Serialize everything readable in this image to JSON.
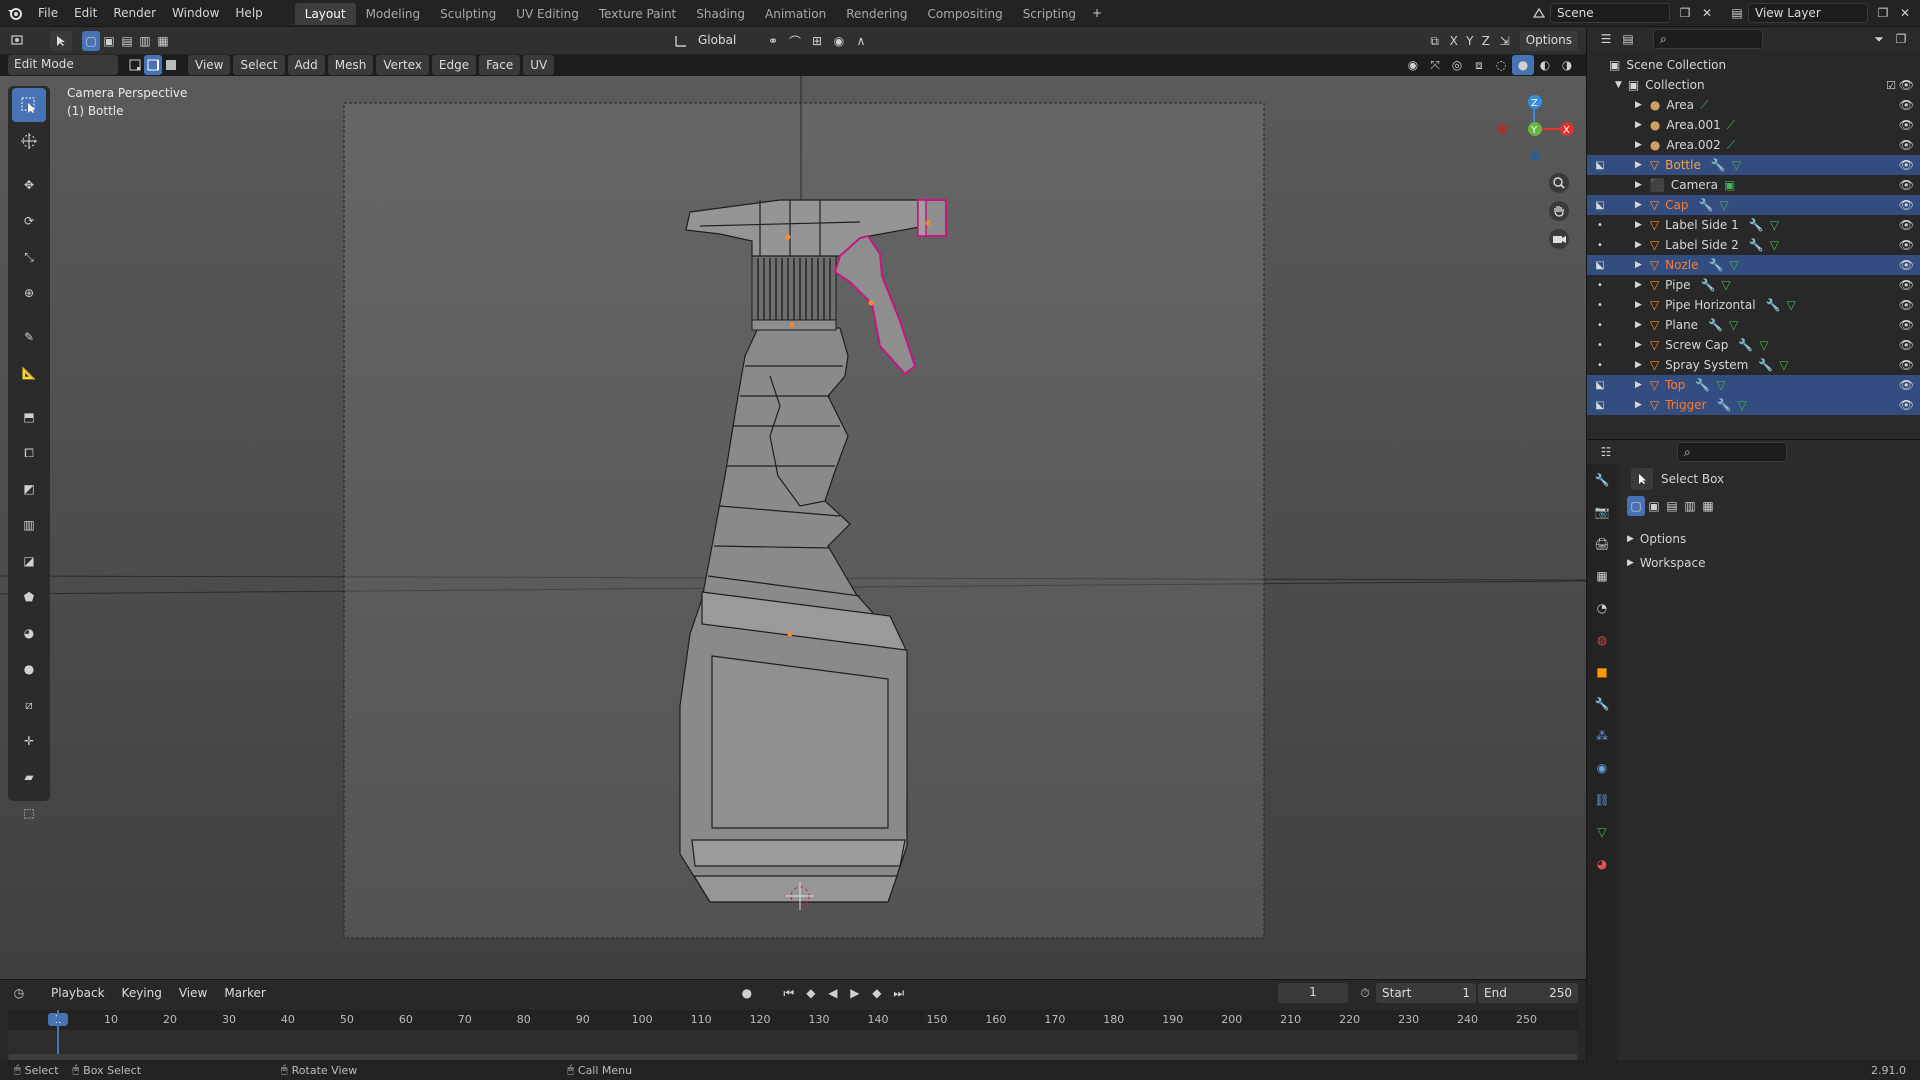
{
  "menubar": {
    "items": [
      "File",
      "Edit",
      "Render",
      "Window",
      "Help"
    ],
    "workspaces": [
      "Layout",
      "Modeling",
      "Sculpting",
      "UV Editing",
      "Texture Paint",
      "Shading",
      "Animation",
      "Rendering",
      "Compositing",
      "Scripting"
    ],
    "active_workspace": "Layout",
    "scene_label": "Scene",
    "view_layer_label": "View Layer"
  },
  "viewport_header": {
    "mode": "Edit Mode",
    "menus": [
      "View",
      "Select",
      "Add",
      "Mesh",
      "Vertex",
      "Edge",
      "Face",
      "UV"
    ],
    "transform_orientation": "Global",
    "axis_labels": [
      "X",
      "Y",
      "Z"
    ],
    "options_label": "Options"
  },
  "viewport": {
    "view_name": "Camera Perspective",
    "object_name": "(1) Bottle",
    "gizmo_labels": {
      "z": "Z",
      "y": "Y",
      "x": "X"
    }
  },
  "outliner": {
    "root": "Scene Collection",
    "collection": "Collection",
    "items": [
      {
        "name": "Area",
        "type": "light",
        "selected": false,
        "edit": false,
        "color": "#d6d6d6"
      },
      {
        "name": "Area.001",
        "type": "light",
        "selected": false,
        "edit": false,
        "color": "#d6d6d6"
      },
      {
        "name": "Area.002",
        "type": "light",
        "selected": false,
        "edit": false,
        "color": "#d6d6d6"
      },
      {
        "name": "Bottle",
        "type": "mesh",
        "selected": true,
        "edit": true,
        "color": "#ff9e40"
      },
      {
        "name": "Camera",
        "type": "camera",
        "selected": false,
        "edit": false,
        "color": "#d6d6d6"
      },
      {
        "name": "Cap",
        "type": "mesh",
        "selected": true,
        "edit": true,
        "color": "#ff7a2a"
      },
      {
        "name": "Label Side 1",
        "type": "mesh",
        "selected": false,
        "edit": false,
        "color": "#d6d6d6"
      },
      {
        "name": "Label Side 2",
        "type": "mesh",
        "selected": false,
        "edit": false,
        "color": "#d6d6d6"
      },
      {
        "name": "Nozle",
        "type": "mesh",
        "selected": true,
        "edit": true,
        "color": "#ff7a2a"
      },
      {
        "name": "Pipe",
        "type": "mesh",
        "selected": false,
        "edit": false,
        "color": "#d6d6d6"
      },
      {
        "name": "Pipe Horizontal",
        "type": "mesh",
        "selected": false,
        "edit": false,
        "color": "#d6d6d6"
      },
      {
        "name": "Plane",
        "type": "mesh",
        "selected": false,
        "edit": false,
        "color": "#d6d6d6"
      },
      {
        "name": "Screw Cap",
        "type": "mesh",
        "selected": false,
        "edit": false,
        "color": "#d6d6d6"
      },
      {
        "name": "Spray System",
        "type": "mesh",
        "selected": false,
        "edit": false,
        "color": "#d6d6d6"
      },
      {
        "name": "Top",
        "type": "mesh",
        "selected": true,
        "edit": true,
        "color": "#ff7a2a"
      },
      {
        "name": "Trigger",
        "type": "mesh",
        "selected": true,
        "edit": true,
        "color": "#ff7a2a"
      }
    ]
  },
  "properties": {
    "tool_name": "Select Box",
    "sections": [
      "Options",
      "Workspace"
    ]
  },
  "timeline": {
    "menus": [
      "Playback",
      "Keying",
      "View",
      "Marker"
    ],
    "current_frame": "1",
    "start_label": "Start",
    "start_value": "1",
    "end_label": "End",
    "end_value": "250",
    "ticks": [
      "1",
      "10",
      "20",
      "30",
      "40",
      "50",
      "60",
      "70",
      "80",
      "90",
      "100",
      "110",
      "120",
      "130",
      "140",
      "150",
      "160",
      "170",
      "180",
      "190",
      "200",
      "210",
      "220",
      "230",
      "240",
      "250"
    ]
  },
  "statusbar": {
    "items": [
      "Select",
      "Box Select",
      "Rotate View",
      "Call Menu"
    ],
    "version": "2.91.0"
  },
  "colors": {
    "accent": "#4772b3",
    "selected_row": "#334d80",
    "edit_highlight": "#c5177f",
    "orange": "#ff8a2a"
  }
}
